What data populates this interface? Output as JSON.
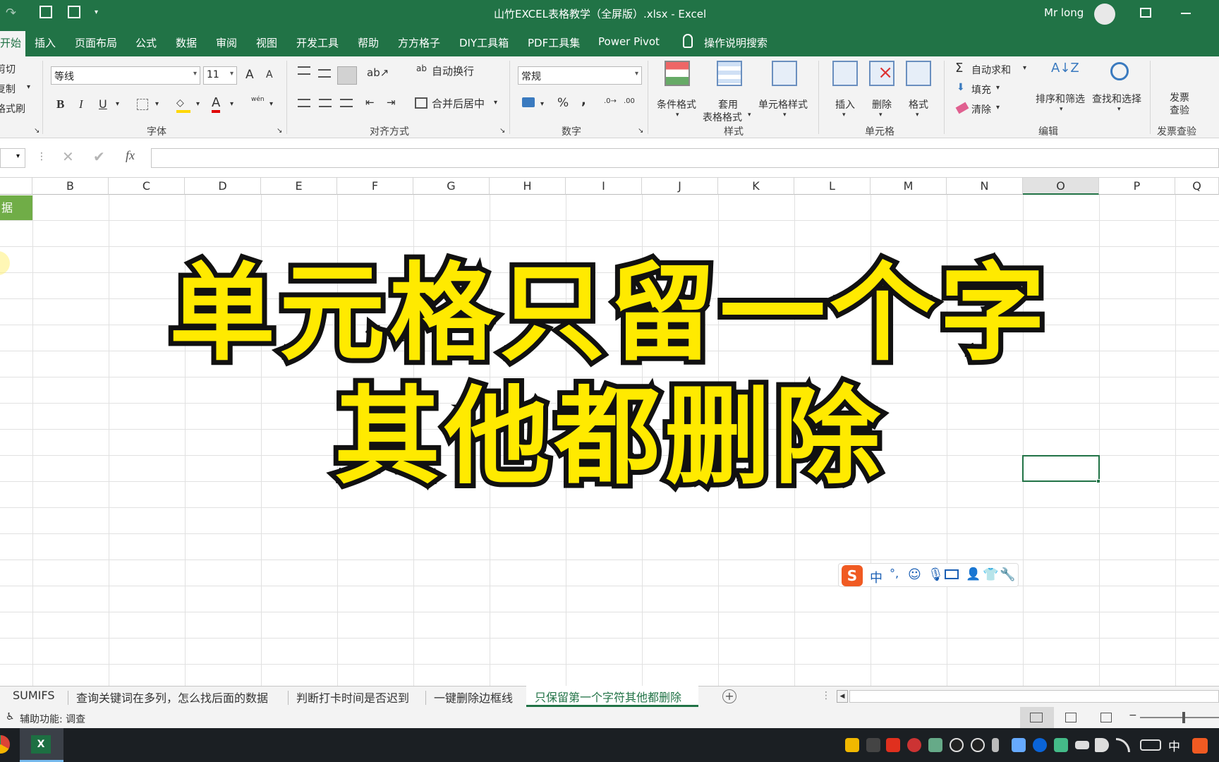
{
  "titlebar": {
    "title": "山竹EXCEL表格教学（全屏版）.xlsx  -  Excel",
    "user_name": "Mr long"
  },
  "ribbon_tabs": {
    "home": "开始",
    "items": [
      "插入",
      "页面布局",
      "公式",
      "数据",
      "审阅",
      "视图",
      "开发工具",
      "帮助",
      "方方格子",
      "DIY工具箱",
      "PDF工具集",
      "Power Pivot"
    ],
    "search": "操作说明搜索"
  },
  "clipboard": {
    "cut": "剪切",
    "copy": "复制",
    "format_painter": "格式刷"
  },
  "font_group": {
    "font_name": "等线",
    "font_size": "11",
    "label": "字体",
    "bold": "B",
    "italic": "I",
    "underline": "U",
    "grow": "A",
    "shrink": "A",
    "font_color": "A",
    "phonetic": "wén"
  },
  "align_group": {
    "wrap": "自动换行",
    "merge": "合并后居中",
    "label": "对齐方式"
  },
  "number_group": {
    "format": "常规",
    "percent": "%",
    "comma": ",",
    "label": "数字"
  },
  "styles_group": {
    "cond": "条件格式",
    "table1": "套用",
    "table2": "表格格式",
    "cell_style": "单元格样式",
    "label": "样式"
  },
  "cells_group": {
    "insert": "插入",
    "delete": "删除",
    "format": "格式",
    "label": "单元格"
  },
  "editing_group": {
    "autosum": "自动求和",
    "fill": "填充",
    "clear": "清除",
    "sort": "排序和筛选",
    "find": "查找和选择",
    "label": "编辑"
  },
  "invoice_group": {
    "btn1": "发票",
    "btn2": "查验",
    "label": "发票查验"
  },
  "formula_bar": {
    "fx": "fx",
    "content": ""
  },
  "columns": [
    "B",
    "C",
    "D",
    "E",
    "F",
    "G",
    "H",
    "I",
    "J",
    "K",
    "L",
    "M",
    "N",
    "O",
    "P",
    "Q"
  ],
  "cell_a1_partial": "据",
  "overlay": {
    "line1": "单元格只留一个字",
    "line2": "其他都删除"
  },
  "ime_toolbar": {
    "mode": "中"
  },
  "sheet_tabs": [
    "SUMIFS",
    "查询关键词在多列，怎么找后面的数据",
    "判断打卡时间是否迟到",
    "一键删除边框线",
    "只保留第一个字符其他都删除"
  ],
  "active_sheet": "只保留第一个字符其他都删除",
  "status": {
    "accessibility": "辅助功能: 调查"
  },
  "taskbar": {
    "ime": "中"
  },
  "colors": {
    "excel_green": "#217346",
    "overlay_yellow": "#ffea00",
    "header_fill": "#70ad47"
  }
}
